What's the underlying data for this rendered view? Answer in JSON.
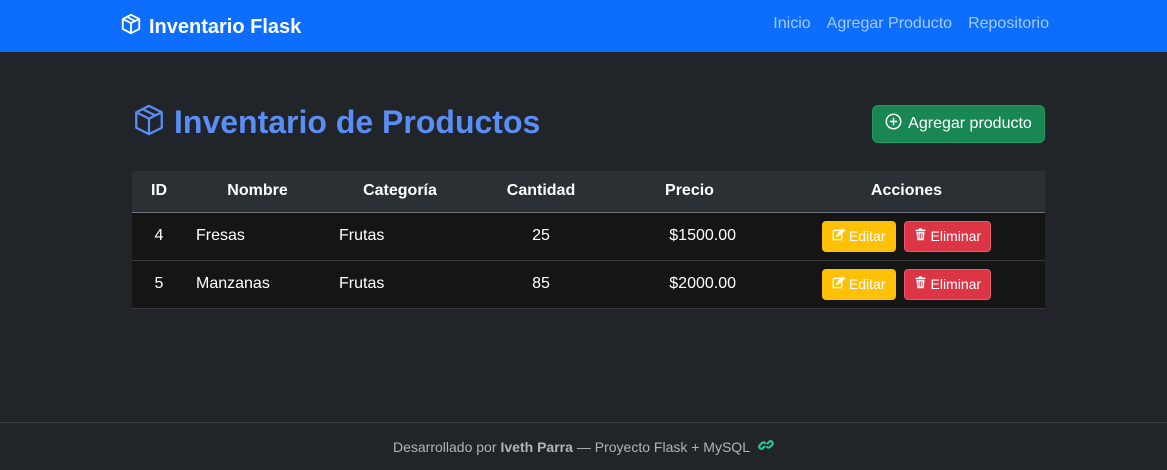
{
  "navbar": {
    "brand": "Inventario Flask",
    "brand_icon": "box-icon",
    "links": [
      "Inicio",
      "Agregar Producto",
      "Repositorio"
    ]
  },
  "header": {
    "title": "Inventario de Productos",
    "title_icon": "box-icon",
    "add_button": "Agregar producto",
    "add_button_icon": "plus-circle-icon"
  },
  "table": {
    "columns": [
      "ID",
      "Nombre",
      "Categoría",
      "Cantidad",
      "Precio",
      "Acciones"
    ],
    "rows": [
      {
        "id": "4",
        "nombre": "Fresas",
        "categoria": "Frutas",
        "cantidad": "25",
        "precio": "$1500.00"
      },
      {
        "id": "5",
        "nombre": "Manzanas",
        "categoria": "Frutas",
        "cantidad": "85",
        "precio": "$2000.00"
      }
    ],
    "edit_label": "Editar",
    "delete_label": "Eliminar"
  },
  "footer": {
    "prefix": "Desarrollado por",
    "author": "Iveth Parra",
    "suffix": "— Proyecto Flask + MySQL",
    "icon": "link-icon"
  },
  "colors": {
    "navbar": "#0d6efd",
    "title": "#5a8ef5",
    "success": "#198754",
    "warning": "#ffc107",
    "danger": "#dc3545",
    "background": "#212529"
  }
}
